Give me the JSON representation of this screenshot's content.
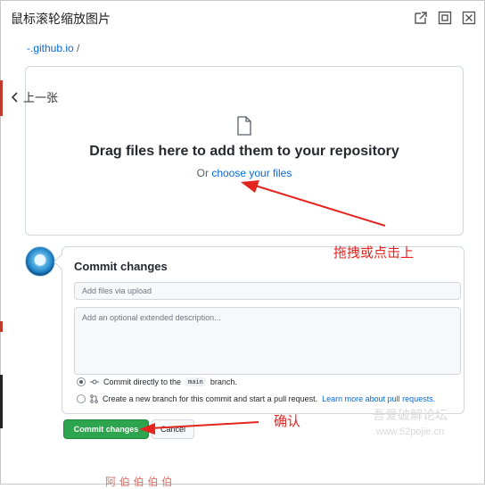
{
  "window": {
    "title": "鼠标滚轮缩放图片"
  },
  "nav": {
    "prev_label": "上一张"
  },
  "breadcrumb": {
    "repo": "-.github.io",
    "separator": "/"
  },
  "dropzone": {
    "title": "Drag files here to add them to your repository",
    "or_text": "Or",
    "choose_link": "choose your files"
  },
  "commit": {
    "title": "Commit changes",
    "summary_placeholder": "Add files via upload",
    "description_placeholder": "Add an optional extended description...",
    "option1_prefix": "Commit directly to the",
    "option1_branch": "main",
    "option1_suffix": "branch.",
    "option2_text": "Create a new branch for this commit and start a pull request.",
    "option2_link": "Learn more about pull requests.",
    "selected_option": "option1"
  },
  "buttons": {
    "commit": "Commit changes",
    "cancel": "Cancel"
  },
  "annotations": {
    "drag_hint": "拖拽或点击上",
    "confirm": "确认"
  },
  "watermark": {
    "name": "吾爱破解论坛",
    "site": "www.52pojie.cn"
  },
  "bottom_fragment": {
    "text": "阿 伯 伯 伯 伯"
  },
  "colors": {
    "annotation": "#e2261f",
    "link": "#0969da",
    "primary_button": "#2da44e"
  },
  "icons": [
    "popout-icon",
    "maximize-icon",
    "close-icon",
    "chevron-left-icon",
    "file-icon",
    "commit-icon",
    "pull-request-icon"
  ]
}
